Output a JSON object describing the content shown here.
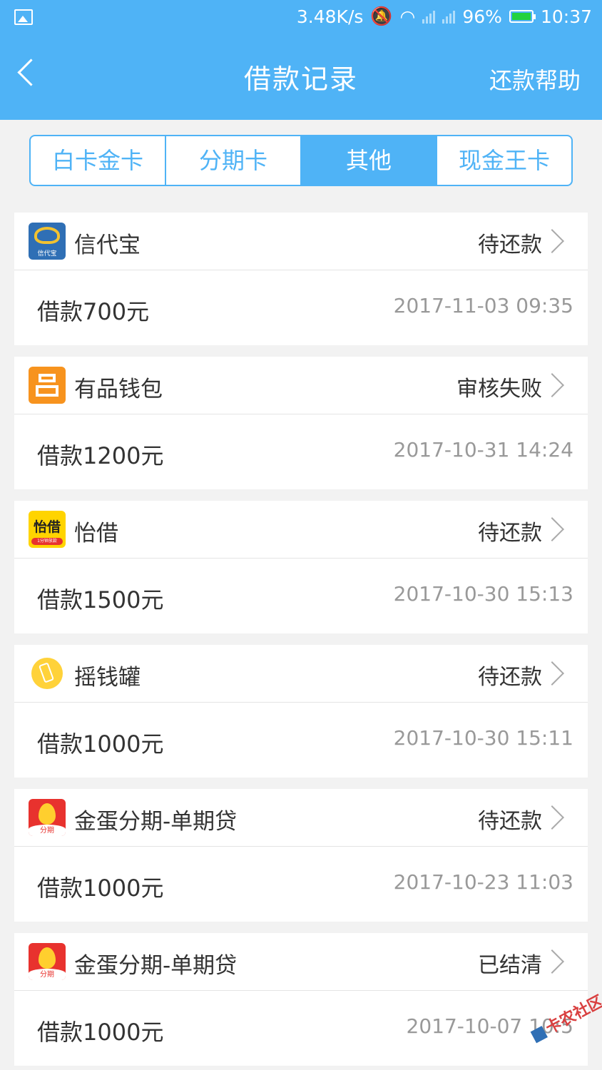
{
  "status_bar": {
    "net_speed": "3.48K/s",
    "battery": "96%",
    "time": "10:37",
    "battery_level": 0.96
  },
  "header": {
    "title": "借款记录",
    "help": "还款帮助"
  },
  "tabs": [
    {
      "label": "白卡金卡",
      "active": false
    },
    {
      "label": "分期卡",
      "active": false
    },
    {
      "label": "其他",
      "active": true
    },
    {
      "label": "现金王卡",
      "active": false
    }
  ],
  "records": [
    {
      "name": "信代宝",
      "logo": "xindaibao-logo",
      "status": "待还款",
      "amount": "借款700元",
      "datetime": "2017-11-03 09:35"
    },
    {
      "name": "有品钱包",
      "logo": "youpin-wallet-logo",
      "status": "审核失败",
      "amount": "借款1200元",
      "datetime": "2017-10-31 14:24"
    },
    {
      "name": "怡借",
      "logo": "yijie-logo",
      "status": "待还款",
      "amount": "借款1500元",
      "datetime": "2017-10-30 15:13"
    },
    {
      "name": "摇钱罐",
      "logo": "yaoqianguan-logo",
      "status": "待还款",
      "amount": "借款1000元",
      "datetime": "2017-10-30 15:11"
    },
    {
      "name": "金蛋分期-单期贷",
      "logo": "jindan-logo",
      "status": "待还款",
      "amount": "借款1000元",
      "datetime": "2017-10-23 11:03"
    },
    {
      "name": "金蛋分期-单期贷",
      "logo": "jindan-logo",
      "status": "已结清",
      "amount": "借款1000元",
      "datetime": "2017-10-07 10:5"
    }
  ],
  "logo_texts": {
    "xindaibao": "信代宝",
    "yijie": "怡借",
    "yijie_sub": "1分钟放款",
    "jindan": "分期"
  },
  "watermark": "卡农社区",
  "colors": {
    "accent": "#4fb3f6",
    "background": "#f2f2f2"
  }
}
